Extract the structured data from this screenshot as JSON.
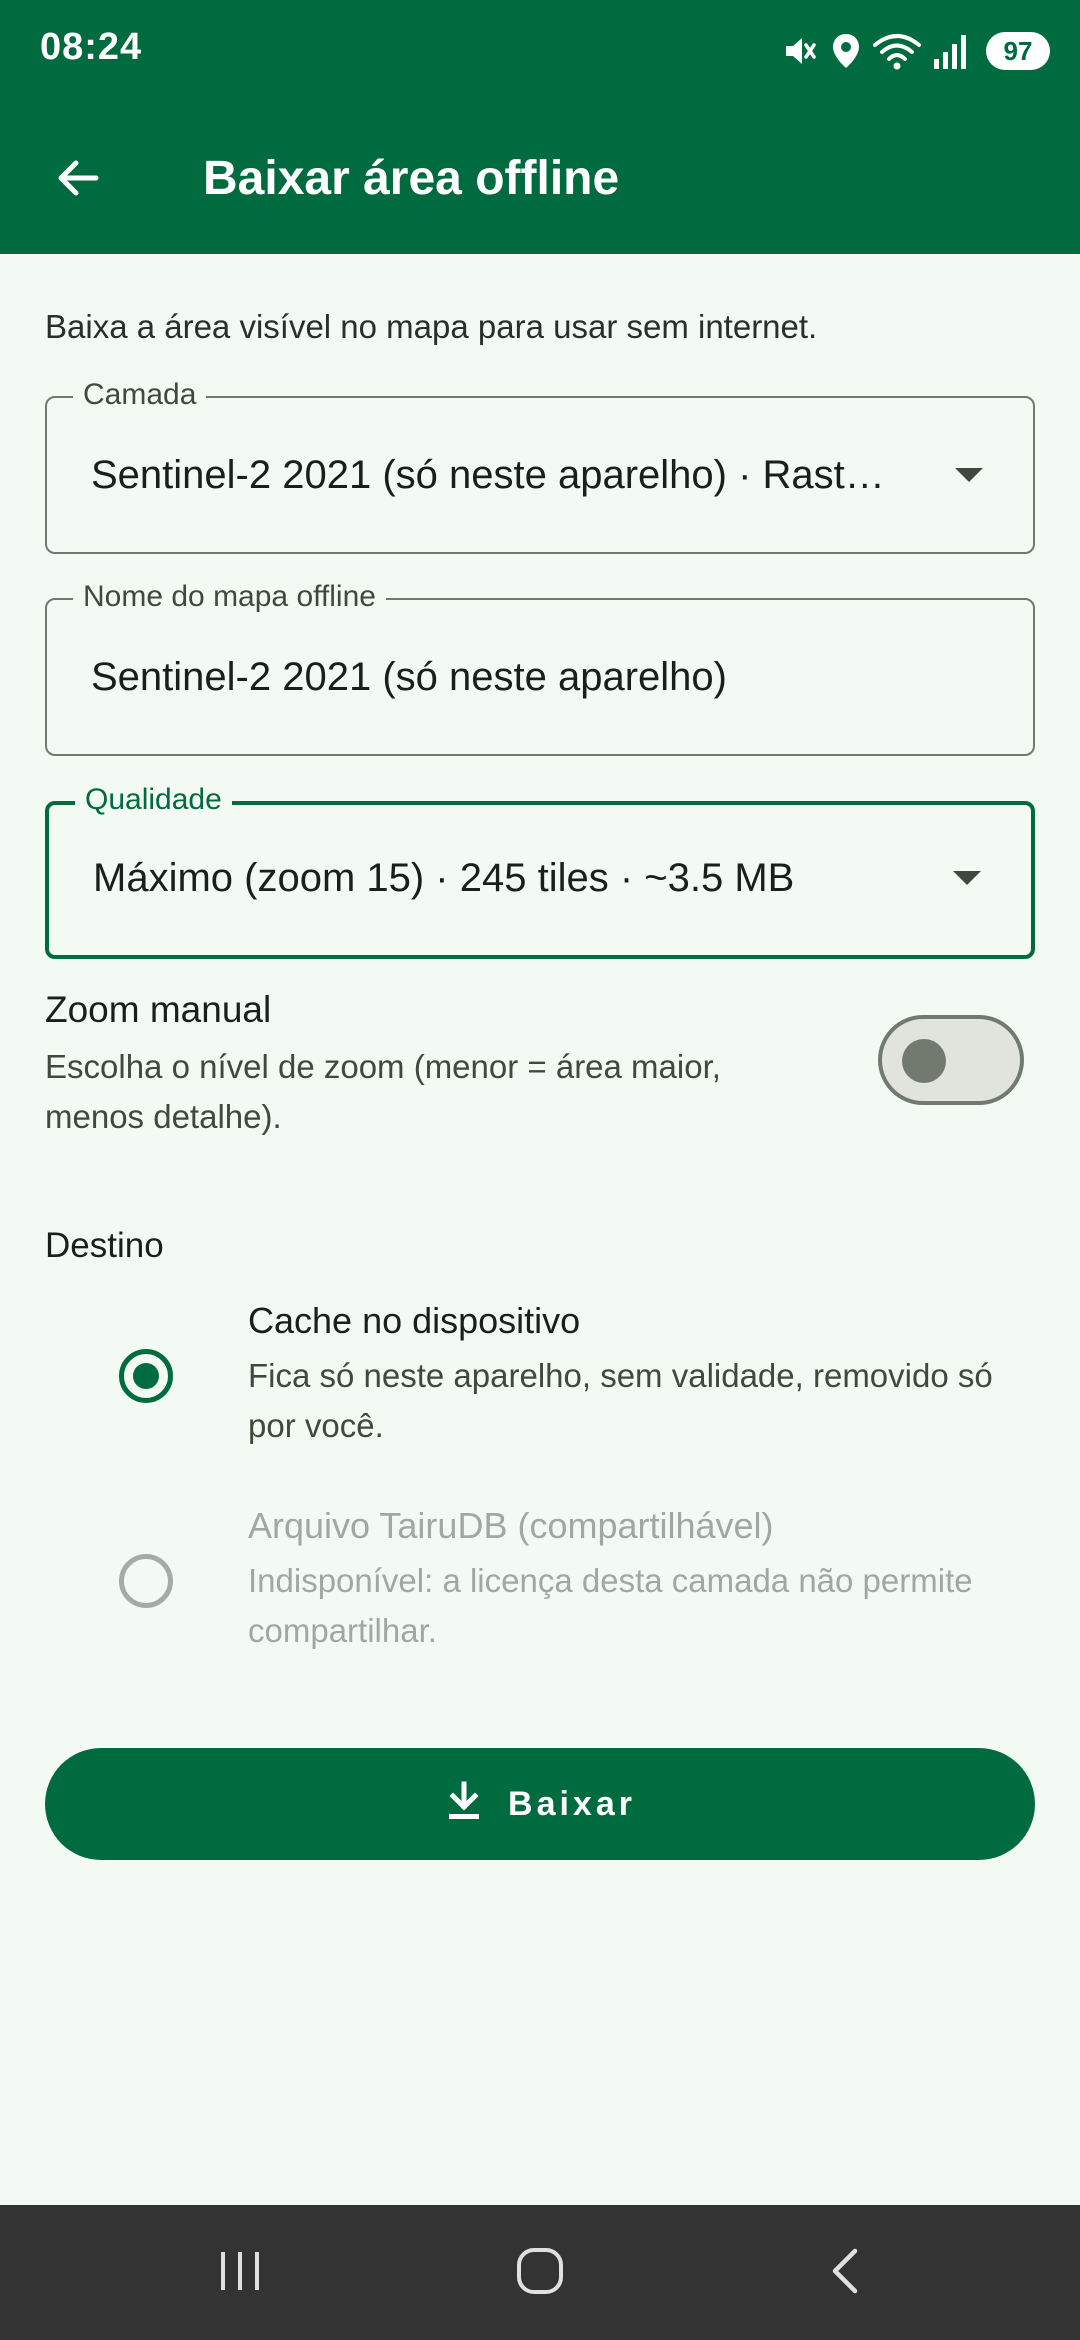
{
  "status_bar": {
    "time": "08:24",
    "icons": [
      "mute-icon",
      "location-icon",
      "wifi-icon",
      "signal-icon"
    ],
    "battery": "97"
  },
  "app_bar": {
    "title": "Baixar área offline",
    "back_icon": "arrow-left-icon"
  },
  "description": "Baixa a área visível no mapa para usar sem internet.",
  "fields": {
    "layer": {
      "label": "Camada",
      "value": "Sentinel-2 2021 (só neste aparelho) · Rast…"
    },
    "map_name": {
      "label": "Nome do mapa offline",
      "value": "Sentinel-2 2021 (só neste aparelho)"
    },
    "quality": {
      "label": "Qualidade",
      "value": "Máximo (zoom 15) · 245 tiles · ~3.5 MB"
    }
  },
  "zoom_manual": {
    "title": "Zoom manual",
    "description": "Escolha o nível de zoom (menor = área maior, menos detalhe).",
    "enabled": false
  },
  "destination": {
    "heading": "Destino",
    "options": [
      {
        "title": "Cache no dispositivo",
        "description": "Fica só neste aparelho, sem validade, removido só por você.",
        "selected": true,
        "disabled": false
      },
      {
        "title": "Arquivo TairuDB (compartilhável)",
        "description": "Indisponível: a licença desta camada não permite compartilhar.",
        "selected": false,
        "disabled": true
      }
    ]
  },
  "download_button": {
    "label": "Baixar",
    "icon": "download-icon"
  },
  "nav_bar": {
    "icons": [
      "recent-apps-icon",
      "home-icon",
      "back-icon"
    ]
  },
  "colors": {
    "primary": "#006b3f",
    "background": "#f3faf3",
    "outline": "#72796f",
    "disabled_text": "#a3a7a2",
    "nav_bar": "#333333"
  }
}
